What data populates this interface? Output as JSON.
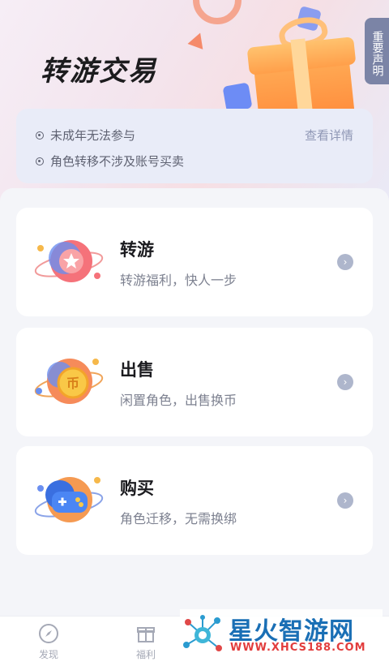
{
  "header": {
    "title": "转游交易",
    "notice_button": "重要声明"
  },
  "rules": {
    "items": [
      "未成年无法参与",
      "角色转移不涉及账号买卖"
    ],
    "detail_link": "查看详情"
  },
  "options": [
    {
      "title": "转游",
      "subtitle": "转游福利，快人一步",
      "icon": "star-planet-icon"
    },
    {
      "title": "出售",
      "subtitle": "闲置角色，出售换币",
      "icon": "coin-planet-icon"
    },
    {
      "title": "购买",
      "subtitle": "角色迁移，无需换绑",
      "icon": "gamepad-planet-icon"
    }
  ],
  "tabs": [
    {
      "label": "发现",
      "icon": "compass-icon"
    },
    {
      "label": "福利",
      "icon": "gift-icon"
    }
  ],
  "watermark": {
    "brand": "星火智游网",
    "url": "WWW.XHCS188.COM"
  },
  "colors": {
    "accent": "#7b84a6",
    "card_bg": "#ffffff",
    "page_bg": "#f4f5f9"
  }
}
